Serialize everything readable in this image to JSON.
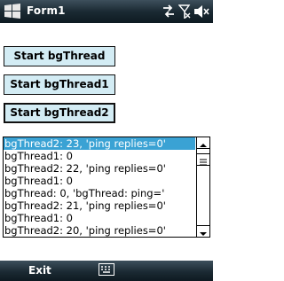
{
  "window": {
    "title": "Form1"
  },
  "buttons": [
    {
      "label": "Start bgThread"
    },
    {
      "label": "Start bgThread1"
    },
    {
      "label": "Start bgThread2"
    }
  ],
  "list": {
    "selected_index": 0,
    "items": [
      "bgThread2: 23, 'ping replies=0'",
      "bgThread1: 0",
      "bgThread2: 22, 'ping replies=0'",
      "bgThread1: 0",
      "bgThread: 0, 'bgThread: ping='",
      "bgThread2: 21, 'ping replies=0'",
      "bgThread1: 0",
      "bgThread2: 20, 'ping replies=0'"
    ]
  },
  "softkeys": {
    "left": "Exit"
  },
  "colors": {
    "bar_dark": "#1b2a33",
    "button_fill": "#d3ecf4",
    "selection": "#3aa2d4"
  }
}
